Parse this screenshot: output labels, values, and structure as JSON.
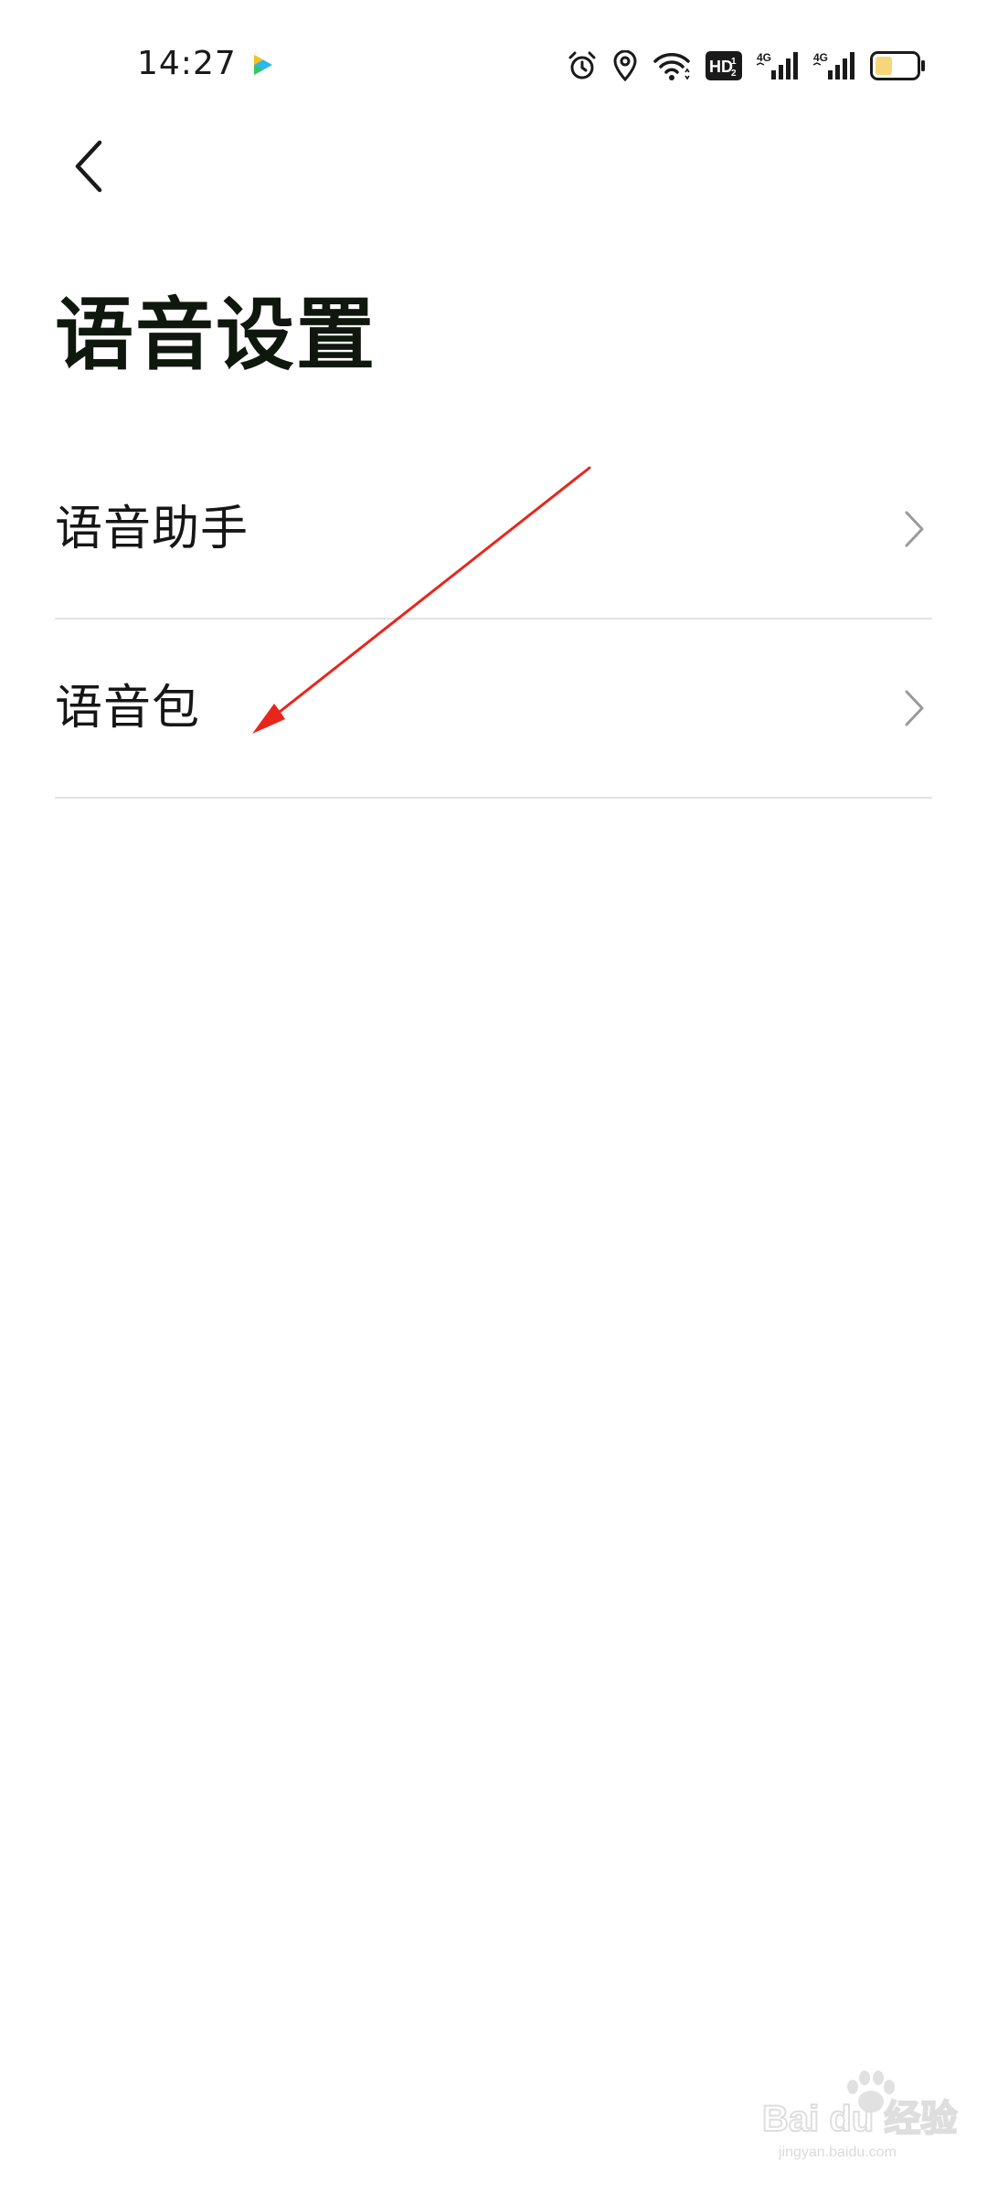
{
  "status_bar": {
    "time": "14:27",
    "icons": [
      "video-app-icon",
      "alarm-icon",
      "location-icon",
      "wifi-icon",
      "hd-icon",
      "signal-4g-icon",
      "signal-4g-icon",
      "battery-icon"
    ],
    "hd_label": "HD",
    "network_label": "4G",
    "battery_color": "#f5d77a"
  },
  "header": {
    "back_icon": "chevron-left-icon",
    "title": "语音设置"
  },
  "settings": {
    "items": [
      {
        "label": "语音助手",
        "icon": "chevron-right-icon"
      },
      {
        "label": "语音包",
        "icon": "chevron-right-icon"
      }
    ]
  },
  "annotation": {
    "color": "#e8261c"
  },
  "watermark": {
    "brand": "Bai du 经验",
    "url": "jingyan.baidu.com"
  }
}
